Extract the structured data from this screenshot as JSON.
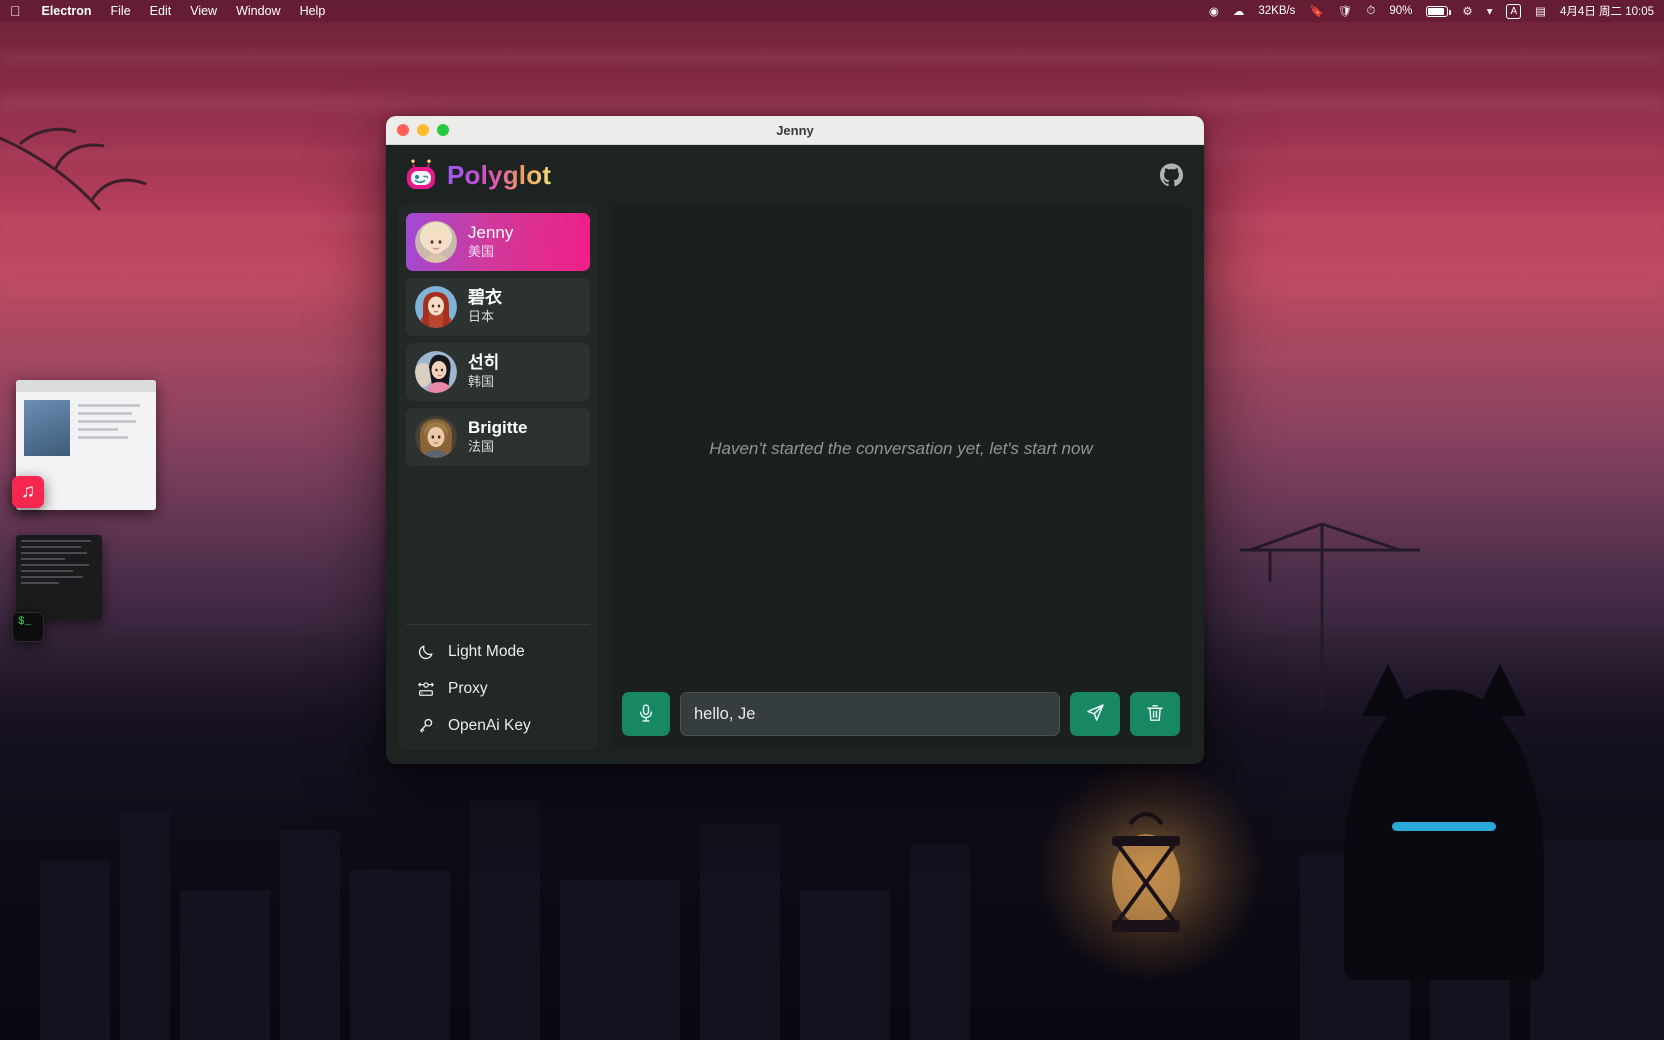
{
  "menubar": {
    "apple_icon": "apple-icon",
    "app_name": "Electron",
    "items": [
      "File",
      "Edit",
      "View",
      "Window",
      "Help"
    ],
    "network_speed": "32KB/s",
    "battery_percent": "90%",
    "input_source": "A",
    "datetime": "4月4日 周二 10:05",
    "right_icons": [
      "dropbox-icon",
      "cloud-icon",
      "bookmark-icon",
      "shield-icon",
      "timer-icon",
      "battery-icon",
      "control-center-icon",
      "wifi-icon",
      "input-source-icon",
      "notification-icon"
    ]
  },
  "window": {
    "title": "Jenny",
    "traffic_lights": [
      "close",
      "minimize",
      "zoom"
    ]
  },
  "header": {
    "brand": "Polyglot",
    "logo_icon": "robot-logo-icon",
    "github_icon": "github-icon"
  },
  "sidebar": {
    "contacts": [
      {
        "name": "Jenny",
        "country": "美国",
        "active": true,
        "avatar": "avatar-jenny"
      },
      {
        "name": "碧衣",
        "country": "日本",
        "active": false,
        "avatar": "avatar-biyi"
      },
      {
        "name": "선히",
        "country": "韩国",
        "active": false,
        "avatar": "avatar-seonhui"
      },
      {
        "name": "Brigitte",
        "country": "法国",
        "active": false,
        "avatar": "avatar-brigitte"
      }
    ],
    "menu": [
      {
        "label": "Light Mode",
        "icon": "moon-icon"
      },
      {
        "label": "Proxy",
        "icon": "proxy-icon"
      },
      {
        "label": "OpenAi Key",
        "icon": "key-icon"
      }
    ]
  },
  "chat": {
    "empty_hint": "Haven't started the conversation yet, let's start now"
  },
  "composer": {
    "mic_icon": "microphone-icon",
    "input_value": "hello, Je",
    "input_placeholder": "",
    "send_icon": "send-icon",
    "clear_icon": "trash-icon"
  },
  "colors": {
    "accent_green": "#188763",
    "active_gradient_start": "#a14ad6",
    "active_gradient_end": "#ef1f86",
    "app_bg": "#1d2320",
    "sidebar_bg": "#222826",
    "chat_bg": "#1b201e"
  }
}
